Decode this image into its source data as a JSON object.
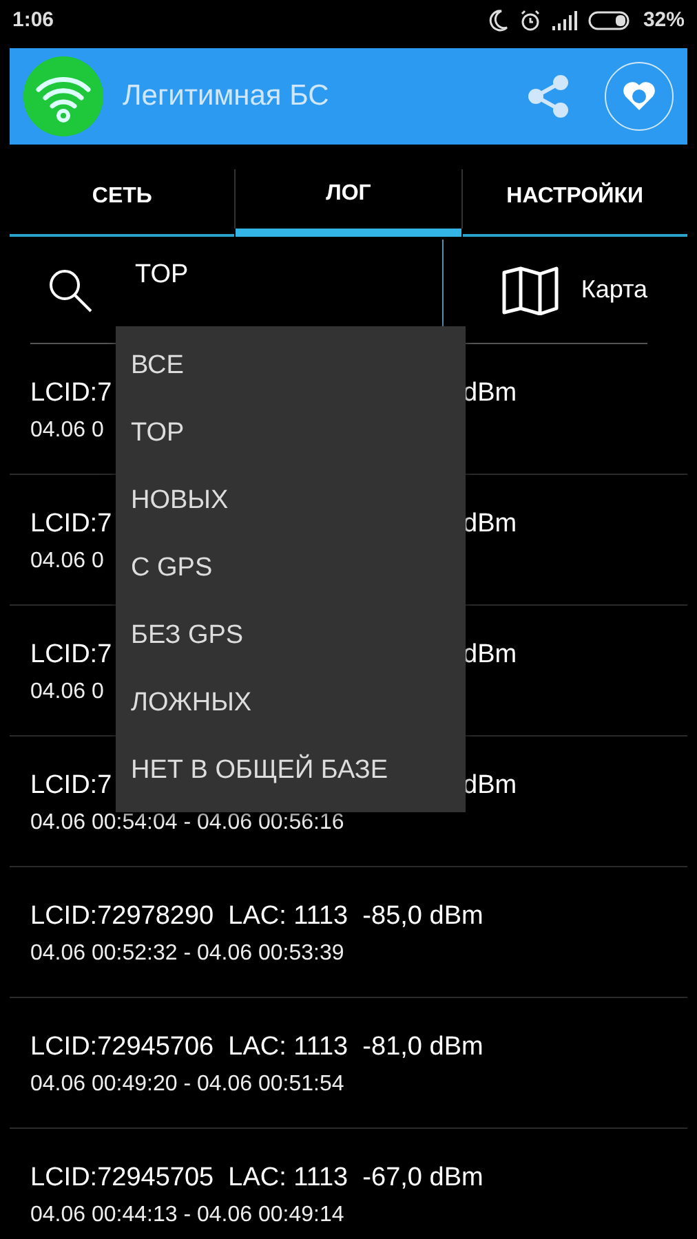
{
  "status_bar": {
    "time": "1:06",
    "battery": "32%"
  },
  "app_bar": {
    "title": "Легитимная БС"
  },
  "tabs": [
    {
      "label": "СЕТЬ",
      "selected": false
    },
    {
      "label": "ЛОГ",
      "selected": true
    },
    {
      "label": "НАСТРОЙКИ",
      "selected": false
    }
  ],
  "filter": {
    "value": "TOP"
  },
  "map_button": {
    "label": "Карта"
  },
  "rows": [
    {
      "line_1": {
        "start": "LCID:7",
        "end": "dBm"
      },
      "line_2": {
        "start": "04.06 0"
      }
    },
    {
      "line_1": {
        "start": "LCID:7",
        "end": "dBm"
      },
      "line_2": {
        "start": "04.06 0"
      }
    },
    {
      "line_1": {
        "start": "LCID:7",
        "end": "dBm"
      },
      "line_2": {
        "start": "04.06 0"
      }
    },
    {
      "line_1": {
        "start": "LCID:7",
        "end": "dBm"
      },
      "line_2": {
        "start": "04.06 00:54:04 - 04.06 00:56:16"
      }
    },
    {
      "line_1": {
        "start": "LCID:72978290  LAC: 1113  -85,0 dBm"
      },
      "line_2": {
        "start": "04.06 00:52:32 - 04.06 00:53:39"
      }
    },
    {
      "line_1": {
        "start": "LCID:72945706  LAC: 1113  -81,0 dBm"
      },
      "line_2": {
        "start": "04.06 00:49:20 - 04.06 00:51:54"
      }
    },
    {
      "line_1": {
        "start": "LCID:72945705  LAC: 1113  -67,0 dBm"
      },
      "line_2": {
        "start": "04.06 00:44:13 - 04.06 00:49:14"
      }
    }
  ],
  "filter_menu": [
    "ВСЕ",
    "TOP",
    "НОВЫХ",
    "С GPS",
    "БЕЗ GPS",
    "ЛОЖНЫХ",
    "НЕТ В ОБЩЕЙ БАЗЕ"
  ]
}
